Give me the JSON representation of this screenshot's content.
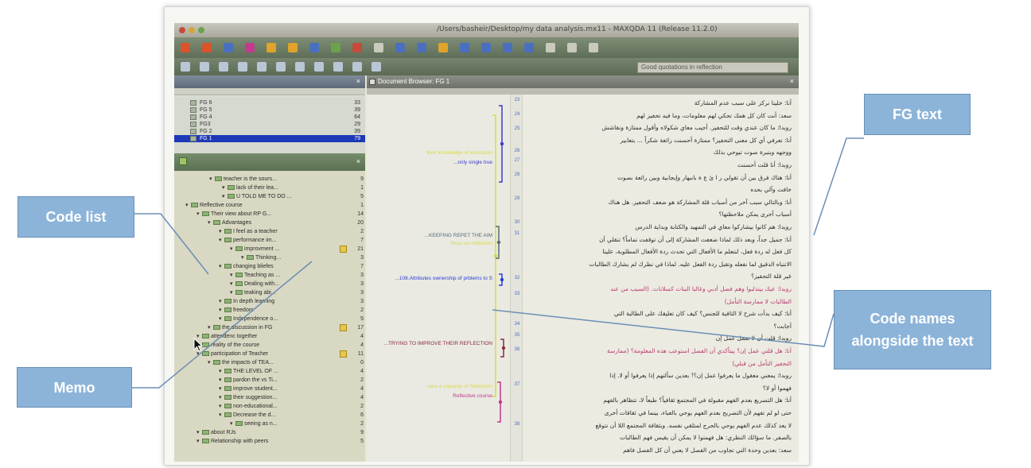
{
  "window": {
    "title": "/Users/basheir/Desktop/my data analysis.mx11 - MAXQDA 11 (Release 11.2.0)",
    "search_value": "Good quotations in reflection"
  },
  "document_browser": {
    "title": "Document Browser: FG 1"
  },
  "documents": [
    {
      "name": "FG 6",
      "count": "33"
    },
    {
      "name": "FG 5",
      "count": "39"
    },
    {
      "name": "FG 4",
      "count": "64"
    },
    {
      "name": "FG3",
      "count": "29"
    },
    {
      "name": "FG 2",
      "count": "39"
    },
    {
      "name": "FG 1",
      "count": "79"
    }
  ],
  "codes": [
    {
      "label": "teacher is the sours...",
      "count": "9"
    },
    {
      "label": "lack of their lea...",
      "count": "1"
    },
    {
      "label": "U TOLD ME TO DO ...",
      "count": "5"
    },
    {
      "label": "Reflective course",
      "count": "1"
    },
    {
      "label": "Their view about RP G...",
      "count": "14"
    },
    {
      "label": "Advantages",
      "count": "20"
    },
    {
      "label": "I feel as a teacher",
      "count": "2"
    },
    {
      "label": "performance  im...",
      "count": "7"
    },
    {
      "label": "improvment ...",
      "count": "21"
    },
    {
      "label": "Thinking...",
      "count": "3"
    },
    {
      "label": "changing bliefes",
      "count": "7"
    },
    {
      "label": "Teaching as ...",
      "count": "3"
    },
    {
      "label": "Dealing with...",
      "count": "3"
    },
    {
      "label": "teaking abi...",
      "count": "3"
    },
    {
      "label": "In depth learning",
      "count": "3"
    },
    {
      "label": "freedom",
      "count": "2"
    },
    {
      "label": "Independence o...",
      "count": "5"
    },
    {
      "label": "the discussion in FG",
      "count": "17"
    },
    {
      "label": "attendenc together",
      "count": "4"
    },
    {
      "label": "reality of the course",
      "count": "4"
    },
    {
      "label": "participation of Teacher",
      "count": "11"
    },
    {
      "label": "the impacts of TEA...",
      "count": "0"
    },
    {
      "label": "THE LEVEL OF ...",
      "count": "4"
    },
    {
      "label": "pardon the vs Ti...",
      "count": "2"
    },
    {
      "label": "improve student...",
      "count": "4"
    },
    {
      "label": "their suggestion...",
      "count": "4"
    },
    {
      "label": "non-educational...",
      "count": "2"
    },
    {
      "label": "Decrease the d...",
      "count": "6"
    },
    {
      "label": "seeing as n...",
      "count": "2"
    },
    {
      "label": "about RJs",
      "count": "9"
    },
    {
      "label": "Relationship with peers",
      "count": "5"
    }
  ],
  "line_numbers": [
    "23",
    "24",
    "25",
    "26",
    "27",
    "28",
    "29",
    "30",
    "31",
    "32",
    "33",
    "34",
    "35",
    "36",
    "37",
    "38"
  ],
  "margin_codes": [
    {
      "text": "their knowledge of education",
      "color": "#d9d94a"
    },
    {
      "text": "...only single true",
      "color": "#3b3bd1"
    },
    {
      "text": "...KEEPING REPET THE AIM",
      "color": "#556b7a"
    },
    {
      "text": "focus on reflection",
      "color": "#d9d94a"
    },
    {
      "text": "...108.Attributes ownership of prblems to S",
      "color": "#2a3dd6"
    },
    {
      "text": "...TRYING TO IMPROVE THEIR REFLECTION",
      "color": "#8b2a3a"
    },
    {
      "text": "view a capacity of Reflection",
      "color": "#d9d94a"
    },
    {
      "text": "Reflective course",
      "color": "#c2378a"
    }
  ],
  "text_lines": [
    {
      "text": "أنا: خلينا نركز على سبب عدم المشاركة",
      "coded": false
    },
    {
      "text": "سعد: أنت كان كل همك تحكي لهم معلومات، وما فيه تحفيز لهم",
      "coded": false
    },
    {
      "text": "روبدا: ما كان عندي وقت للتحفيز. أجيب معاي شكولاه وأقول ممتازة ونقاشش",
      "coded": false
    },
    {
      "text": "أنا: تعرفي أي كل معنى التحفيز؟ ممتازة أحسنت رائعة شكراً ... بتعابير",
      "coded": false
    },
    {
      "text": "ووجهه وبنبرة صوت تيوحي بذلك",
      "coded": false
    },
    {
      "text": "روبدا: أنا قلت أحسنت",
      "coded": false
    },
    {
      "text": "أنا: هناك فرق بين أن تقولي ر ا ئ ع ة بانبهار وإيجابية وبين رائعة بصوت",
      "coded": false
    },
    {
      "text": "خافت وآلي بحده",
      "coded": false
    },
    {
      "text": "أنا: وبالتالي سبب آخر من أسباب قلة المشاركة هو ضعف التحفيز. هل هناك",
      "coded": false
    },
    {
      "text": "أسباب أخرى يمكن ملاحظتها؟",
      "coded": false
    },
    {
      "text": "روبدا: هم كانوا بيشاركوا معاي في التمهيد والكتابة وبداية الدرس",
      "coded": false
    },
    {
      "text": "أنا: جميل جداً، وبعد ذلك لماذا ضعفت المشاركة إلى أن توقفت تماماً؟ تنقلي أن",
      "coded": false
    },
    {
      "text": "كل فعل له ردة فعل، لنتعلم ما الأفعال التي تحدث ردة الأفعال المطلوبة، علينا",
      "coded": false
    },
    {
      "text": "الانتباه الدقيق لما نفعله وتقبل ردة الفعل عليه. لماذا في نظرك لم يشارك الطالبات",
      "coded": false
    },
    {
      "text": "غير قلة التحفيز؟",
      "coded": false
    },
    {
      "text": "روبدا: عيك بيتذلبوا وهم فصل أدبي وغالبا البنات كسلانات. (السبب من عند",
      "coded": true
    },
    {
      "text": "الطالبات لا ممارسة التأمل)",
      "coded": true
    },
    {
      "text": "أنا: كيف بدأت شرح لا الثافية للجنس؟ كيف كان تعليقك على الطالبة التي",
      "coded": false
    },
    {
      "text": "أجابت؟",
      "coded": false
    },
    {
      "text": "روبدا: قلت أن لا تعمل عمل إن",
      "coded": false
    },
    {
      "text": "أنا: هل قلتي عمل إن؟ ييتأكدي أن الفصل استوعب هذه المعلومة؟ (ممارسة",
      "coded": true
    },
    {
      "text": "التحفيز التأمل من قبلي)",
      "coded": true
    },
    {
      "text": "روبدا: يمعني معقول ما يعرفوا عمل إن؟! بعدين سألتهم إذا يعرفوا أو لا. إذا",
      "coded": false
    },
    {
      "text": "فهموا أو لا؟",
      "coded": false
    },
    {
      "text": "أنا: هل التسريع بعدم الفهم مقبولة في المجتمع ثقافياً؟ طبعاً لا، تتظاهر بالفهم",
      "coded": false
    },
    {
      "text": "حتى لو لم تفهم لأن التصريح بعدم الفهم يوحي بالغباء، بينما في ثقافات أخرى",
      "coded": false
    },
    {
      "text": "لا يعد كذلك عدم الفهم يوحي بالحرج لمتلقي نفسه. وبثقافة المجتمع اللا أن نتوقع",
      "coded": false
    },
    {
      "text": "بالصفر. ما سؤالك النظري: هل فهمتوا لا يمكن أن يقيس فهم الطالبات",
      "coded": false
    },
    {
      "text": "سعد: بعدين وحدة التي تجاوب من الفصل لا يعني أن كل الفصل فاهم",
      "coded": false
    }
  ],
  "callouts": {
    "fg_text": "FG text",
    "code_list": "Code list",
    "code_names": "Code names alongside the text",
    "memo": "Memo"
  }
}
